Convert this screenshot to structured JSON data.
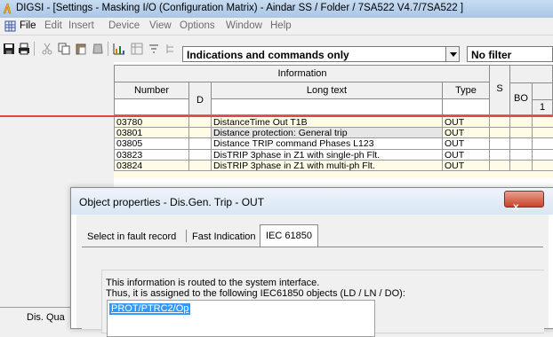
{
  "window": {
    "title": "DIGSI - [Settings - Masking I/O (Configuration Matrix) - Aindar SS / Folder / 7SA522 V4.7/7SA522 ]"
  },
  "menu": [
    "File",
    "Edit",
    "Insert",
    "Device",
    "View",
    "Options",
    "Window",
    "Help"
  ],
  "toolbar": {
    "icons": [
      "save-icon",
      "print-icon",
      "cut-icon",
      "copy-icon",
      "paste-icon",
      "clear-icon",
      "graph-icon",
      "matrix-icon",
      "filter-icon",
      "hierarchy-icon"
    ],
    "view_combo": "Indications and commands only",
    "filter_combo": "No filter"
  },
  "matrix": {
    "group_header": "Information",
    "columns": {
      "number": "Number",
      "d": "D",
      "long_text": "Long text",
      "type": "Type",
      "s": "S",
      "bo": "BO",
      "bo_1": "1"
    },
    "rows": [
      {
        "number": "03780",
        "long_text": "DistanceTime Out T1B",
        "type": "OUT",
        "selected": false
      },
      {
        "number": "03801",
        "long_text": "Distance protection: General trip",
        "type": "OUT",
        "selected": true
      },
      {
        "number": "03805",
        "long_text": "Distance TRIP command Phases L123",
        "type": "OUT",
        "selected": false
      },
      {
        "number": "03823",
        "long_text": "DisTRIP 3phase in Z1 with single-ph Flt.",
        "type": "OUT",
        "selected": false
      },
      {
        "number": "03824",
        "long_text": "DisTRIP 3phase in Z1 with multi-ph Flt.",
        "type": "OUT",
        "selected": false
      }
    ],
    "left_truncated_label": "Dis. Qua"
  },
  "dialog": {
    "title": "Object properties - Dis.Gen. Trip - OUT",
    "close_label": "x",
    "tabs": [
      "Select in fault record",
      "Fast Indication",
      "IEC 61850"
    ],
    "active_tab": "IEC 61850",
    "line1": "This information is routed to the system interface.",
    "line2": "Thus, it is assigned to the following IEC61850 objects (LD / LN / DO):",
    "objects": [
      "PROT/PTRC2/Op"
    ]
  },
  "colors": {
    "highlight_row": "#fefbe6",
    "selection": "#3399ff",
    "red_line": "#d94b4b",
    "accent_orange": "#f4a91c"
  }
}
